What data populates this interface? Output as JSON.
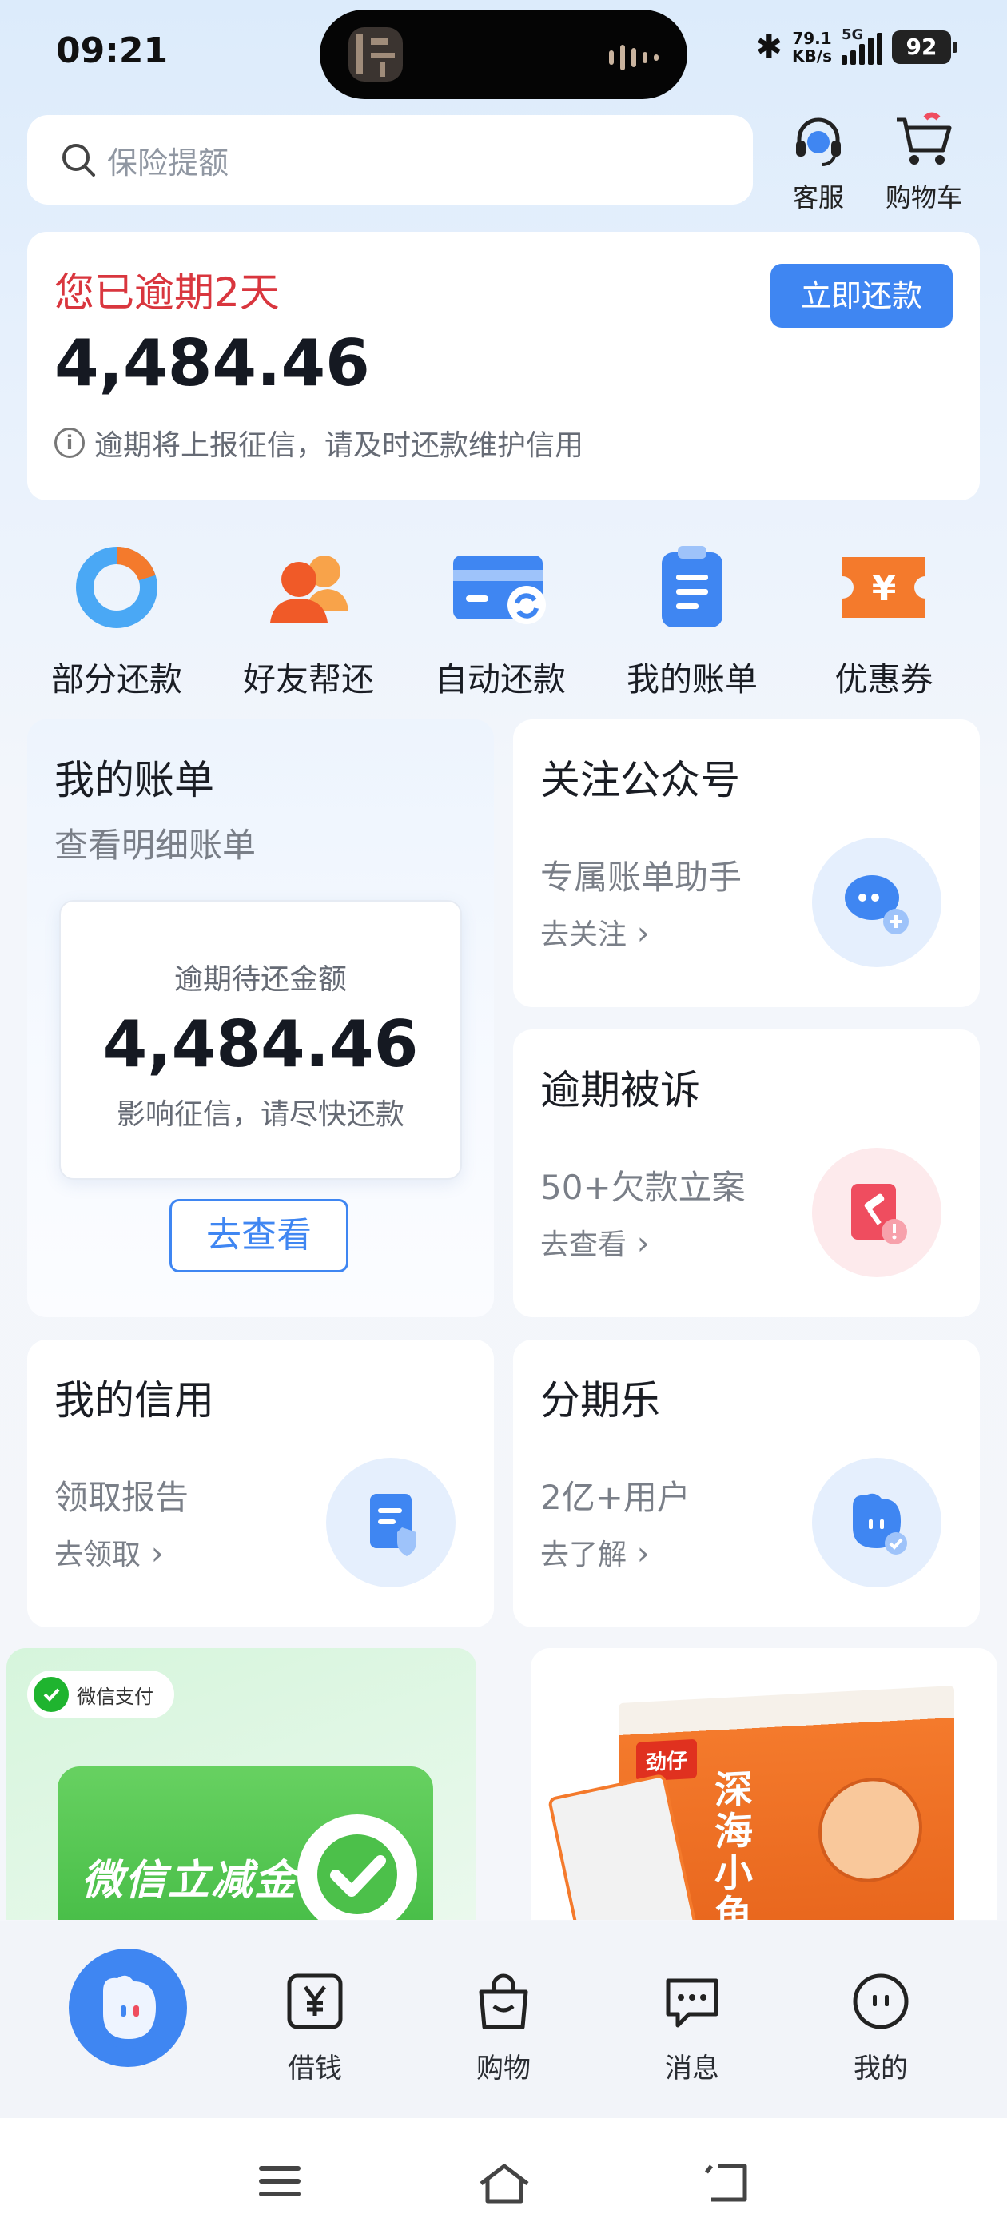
{
  "status_bar": {
    "time": "09:21",
    "net_speed_value": "79.1",
    "net_speed_unit": "KB/s",
    "network": "5G",
    "battery": "92"
  },
  "search": {
    "placeholder": "保险提额"
  },
  "top_actions": {
    "service": "客服",
    "cart": "购物车"
  },
  "overdue": {
    "title": "您已逾期2天",
    "amount": "4,484.46",
    "tip": "逾期将上报征信，请及时还款维护信用",
    "pay_button": "立即还款"
  },
  "quick_actions": [
    {
      "label": "部分还款",
      "icon": "pie-progress-icon"
    },
    {
      "label": "好友帮还",
      "icon": "friends-icon"
    },
    {
      "label": "自动还款",
      "icon": "card-sync-icon"
    },
    {
      "label": "我的账单",
      "icon": "clipboard-icon"
    },
    {
      "label": "优惠券",
      "icon": "coupon-icon"
    }
  ],
  "bill_card": {
    "title": "我的账单",
    "subtitle": "查看明细账单",
    "inner_label": "逾期待还金额",
    "inner_amount": "4,484.46",
    "inner_tip": "影响征信，请尽快还款",
    "button": "去查看"
  },
  "follow_card": {
    "title": "关注公众号",
    "subtitle": "专属账单助手",
    "link": "去关注"
  },
  "lawsuit_card": {
    "title": "逾期被诉",
    "subtitle": "50+欠款立案",
    "link": "去查看"
  },
  "credit_card": {
    "title": "我的信用",
    "subtitle": "领取报告",
    "link": "去领取"
  },
  "fenqile_card": {
    "title": "分期乐",
    "subtitle": "2亿+用户",
    "link": "去了解"
  },
  "ads": {
    "wechat_badge": "微信支付",
    "wechat_text": "微信立减金",
    "snack_brand": "劲仔",
    "snack_title": "深海小鱼"
  },
  "bottom_nav": [
    {
      "label": "借钱",
      "icon": "yen-icon"
    },
    {
      "label": "购物",
      "icon": "shopping-bag-icon"
    },
    {
      "label": "消息",
      "icon": "message-icon"
    },
    {
      "label": "我的",
      "icon": "profile-icon"
    }
  ],
  "colors": {
    "primary": "#3f86f2",
    "overdue_red": "#d9363e",
    "coupon_orange": "#f47a2c"
  }
}
